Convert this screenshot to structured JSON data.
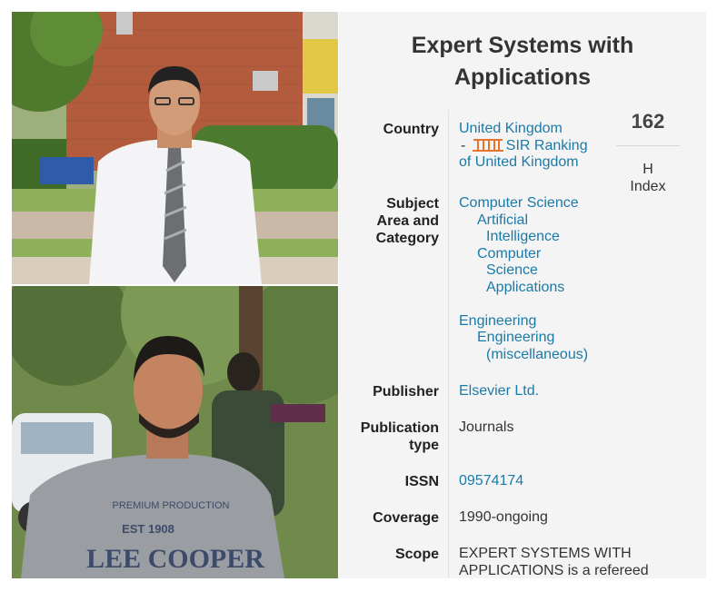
{
  "journal": {
    "title_line1": "Expert Systems with",
    "title_line2": "Applications",
    "country": {
      "label": "Country",
      "value": "United Kingdom",
      "dash": "-",
      "sir_link_text": "SIR Ranking",
      "sir_link_suffix": "of United Kingdom"
    },
    "subject": {
      "label_line1": "Subject",
      "label_line2": "Area and",
      "label_line3": "Category",
      "area1": "Computer Science",
      "area1_cat1": "Artificial Intelligence",
      "area1_cat2": "Computer Science Applications",
      "area2": "Engineering",
      "area2_cat1": "Engineering (miscellaneous)"
    },
    "publisher": {
      "label": "Publisher",
      "value": "Elsevier Ltd."
    },
    "publication_type": {
      "label_line1": "Publication",
      "label_line2": "type",
      "value": "Journals"
    },
    "issn": {
      "label": "ISSN",
      "value": "09574174"
    },
    "coverage": {
      "label": "Coverage",
      "value": "1990-ongoing"
    },
    "scope": {
      "label": "Scope",
      "value": "EXPERT SYSTEMS WITH APPLICATIONS is a refereed"
    },
    "h_index": {
      "value": "162",
      "label_line1": "H",
      "label_line2": "Index"
    }
  },
  "photos": {
    "bottom_shirt_text_line1": "PREMIUM PRODUCTION",
    "bottom_shirt_text_line2": "EST 1908",
    "bottom_shirt_text_line3": "LEE COOPER"
  },
  "colors": {
    "link": "#1a7aa8",
    "card_bg": "#f4f4f4",
    "sir_icon": "#e8732b"
  }
}
